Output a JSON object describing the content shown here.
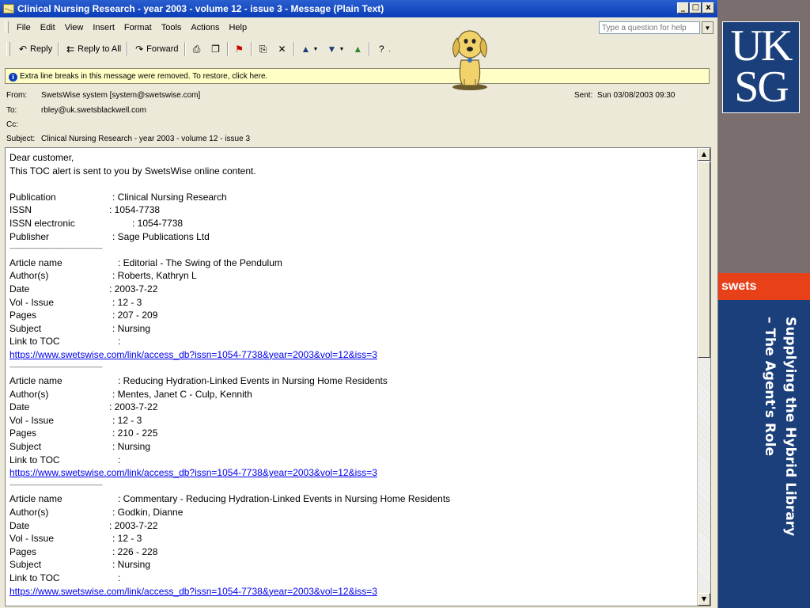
{
  "window": {
    "title": "Clinical Nursing Research - year 2003 - volume 12 - issue 3  - Message (Plain Text)",
    "controls": [
      "_",
      "□",
      "x"
    ]
  },
  "menu": [
    "File",
    "Edit",
    "View",
    "Insert",
    "Format",
    "Tools",
    "Actions",
    "Help"
  ],
  "help_box": {
    "placeholder": "Type a question for help"
  },
  "toolbar": {
    "reply": "Reply",
    "reply_all": "Reply to All",
    "forward": "Forward"
  },
  "infobar": "Extra line breaks in this message were removed. To restore, click here.",
  "header": {
    "from_label": "From:",
    "from": "SwetsWise system [system@swetswise.com]",
    "to_label": "To:",
    "to": "rbley@uk.swetsblackwell.com",
    "cc_label": "Cc:",
    "cc": "",
    "subject_label": "Subject:",
    "subject": "Clinical Nursing Research - year 2003 - volume 12 - issue 3",
    "sent_label": "Sent:",
    "sent": "Sun 03/08/2003 09:30"
  },
  "body": {
    "greeting": "Dear customer,",
    "intro": "This TOC alert is sent to you by SwetsWise online content.",
    "pub_label": "Publication",
    "pub": ": Clinical Nursing Research",
    "issn_label": "ISSN",
    "issn": ": 1054-7738",
    "eissn_label": "ISSN electronic",
    "eissn": ": 1054-7738",
    "publisher_label": "Publisher",
    "publisher": ": Sage Publications Ltd",
    "divider": "----------------------------------------------------------------",
    "labels": {
      "article": "Article name",
      "author": "Author(s)",
      "date": "Date",
      "vol": "Vol - Issue",
      "pages": "Pages",
      "subject": "Subject",
      "toc": "Link to TOC"
    },
    "articles": [
      {
        "name": ": Editorial - The Swing of the Pendulum",
        "author": ": Roberts, Kathryn L",
        "date": ": 2003-7-22",
        "vol": ": 12 - 3",
        "pages": ": 207 - 209",
        "subject": ": Nursing",
        "toc": ":",
        "link": "https://www.swetswise.com/link/access_db?issn=1054-7738&year=2003&vol=12&iss=3"
      },
      {
        "name": ": Reducing Hydration-Linked Events in Nursing Home Residents",
        "author": ": Mentes, Janet C - Culp, Kennith",
        "date": ": 2003-7-22",
        "vol": ": 12 - 3",
        "pages": ": 210 - 225",
        "subject": ": Nursing",
        "toc": ":",
        "link": "https://www.swetswise.com/link/access_db?issn=1054-7738&year=2003&vol=12&iss=3"
      },
      {
        "name": ": Commentary - Reducing Hydration-Linked Events in Nursing Home Residents",
        "author": ": Godkin, Dianne",
        "date": ": 2003-7-22",
        "vol": ": 12 - 3",
        "pages": ": 226 - 228",
        "subject": ": Nursing",
        "toc": ":",
        "link": "https://www.swetswise.com/link/access_db?issn=1054-7738&year=2003&vol=12&iss=3"
      }
    ]
  },
  "slide": {
    "logo_line1": "UK",
    "logo_line2": "SG",
    "brand": "swets",
    "title": "Supplying the Hybrid Library – The Agent's Role",
    "colors": {
      "navy": "#1b3f7a",
      "orange": "#e8411a",
      "taupe": "#7a6e6e"
    }
  }
}
